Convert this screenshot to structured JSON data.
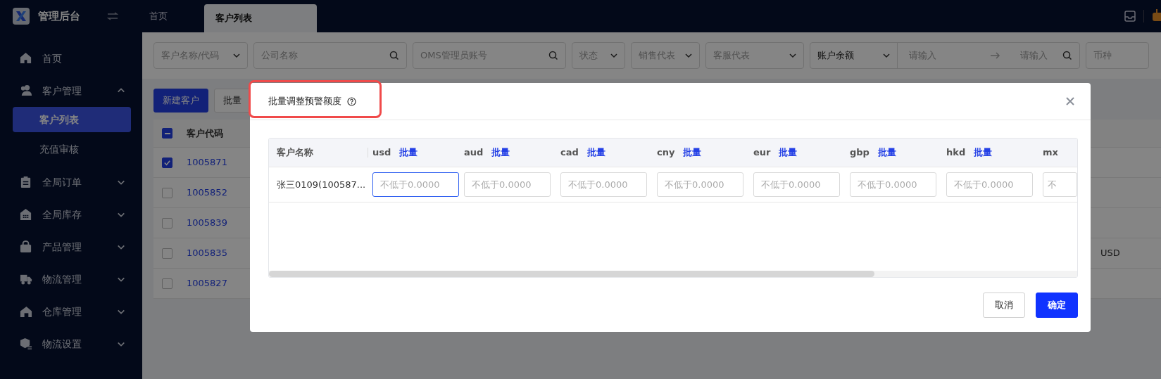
{
  "app": {
    "title": "管理后台"
  },
  "tabs": [
    {
      "label": "首页",
      "selected": false
    },
    {
      "label": "客户列表",
      "selected": true
    }
  ],
  "sidebar": {
    "items": [
      {
        "label": "首页"
      },
      {
        "label": "客户管理",
        "expanded": true,
        "children": [
          {
            "label": "客户列表",
            "selected": true
          },
          {
            "label": "充值审核",
            "selected": false
          }
        ]
      },
      {
        "label": "全局订单",
        "expanded": false
      },
      {
        "label": "全局库存",
        "expanded": false
      },
      {
        "label": "产品管理",
        "expanded": false
      },
      {
        "label": "物流管理",
        "expanded": false
      },
      {
        "label": "仓库管理",
        "expanded": false
      },
      {
        "label": "物流设置",
        "expanded": false
      }
    ]
  },
  "filters": [
    {
      "kind": "select",
      "placeholder": "客户名称/代码"
    },
    {
      "kind": "search",
      "placeholder": "公司名称"
    },
    {
      "kind": "search",
      "placeholder": "OMS管理员账号"
    },
    {
      "kind": "select",
      "placeholder": "状态"
    },
    {
      "kind": "select",
      "placeholder": "销售代表"
    },
    {
      "kind": "select",
      "placeholder": "客服代表"
    },
    {
      "kind": "range",
      "value": "账户余额",
      "from_placeholder": "请输入",
      "to_placeholder": "请输入"
    },
    {
      "kind": "plain",
      "placeholder": "币种"
    }
  ],
  "toolbar": [
    {
      "label": "新建客户",
      "kind": "primary"
    },
    {
      "label": "批量",
      "kind": "default"
    }
  ],
  "customer_table": {
    "header_indeterminate": true,
    "columns": [
      "客户代码"
    ],
    "rows": [
      {
        "code": "1005871",
        "checked": true
      },
      {
        "code": "1005852",
        "checked": false
      },
      {
        "code": "1005839",
        "checked": false
      },
      {
        "code": "1005835",
        "checked": false,
        "column_3": "USD"
      },
      {
        "code": "1005827",
        "checked": false
      }
    ]
  },
  "modal": {
    "title": "批量调整预警额度",
    "highlighted": true,
    "name_header": "客户名称",
    "columns": [
      {
        "code": "usd",
        "action": "批量"
      },
      {
        "code": "aud",
        "action": "批量"
      },
      {
        "code": "cad",
        "action": "批量"
      },
      {
        "code": "cny",
        "action": "批量"
      },
      {
        "code": "eur",
        "action": "批量"
      },
      {
        "code": "gbp",
        "action": "批量"
      },
      {
        "code": "hkd",
        "action": "批量"
      },
      {
        "code": "mx"
      }
    ],
    "rows": [
      {
        "name": "张三0109(100587...",
        "inputs": [
          {
            "placeholder": "不低于0.0000",
            "focused": true
          },
          {
            "placeholder": "不低于0.0000",
            "focused": false
          },
          {
            "placeholder": "不低于0.0000",
            "focused": false
          },
          {
            "placeholder": "不低于0.0000",
            "focused": false
          },
          {
            "placeholder": "不低于0.0000",
            "focused": false
          },
          {
            "placeholder": "不低于0.0000",
            "focused": false
          },
          {
            "placeholder": "不低于0.0000",
            "focused": false
          },
          {
            "placeholder": "不",
            "focused": false
          }
        ]
      }
    ],
    "buttons": [
      {
        "label": "取消",
        "kind": "default"
      },
      {
        "label": "确定",
        "kind": "primary"
      }
    ]
  }
}
